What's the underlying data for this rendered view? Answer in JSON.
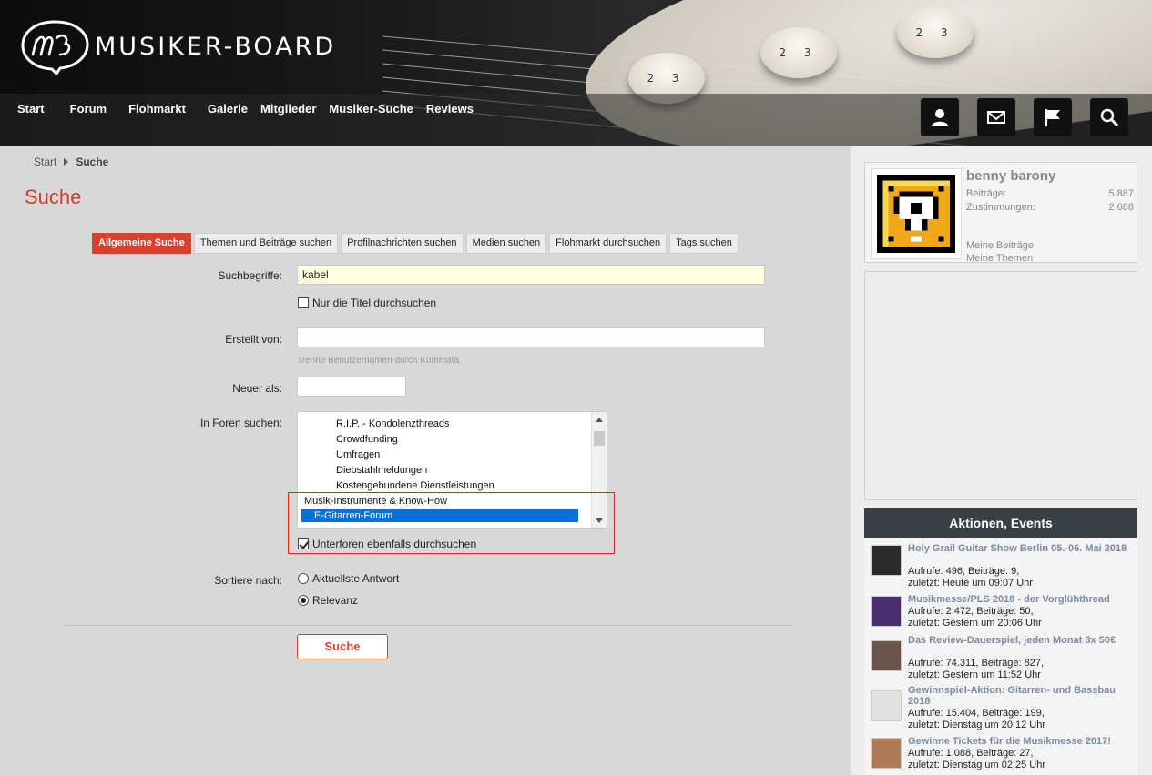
{
  "site": {
    "name": "MUSIKER-BOARD"
  },
  "nav": [
    "Start",
    "Forum",
    "Flohmarkt",
    "Galerie",
    "Mitglieder",
    "Musiker-Suche",
    "Reviews"
  ],
  "breadcrumb": {
    "home": "Start",
    "current": "Suche"
  },
  "page_title": "Suche",
  "tabs": [
    "Allgemeine Suche",
    "Themen und Beiträge suchen",
    "Profilnachrichten suchen",
    "Medien suchen",
    "Flohmarkt durchsuchen",
    "Tags suchen"
  ],
  "form": {
    "keywords_label": "Suchbegriffe:",
    "keywords_value": "kabel",
    "titles_only_label": "Nur die Titel durchsuchen",
    "created_by_label": "Erstellt von:",
    "created_by_hint": "Trenne Benutzernamen durch Kommata.",
    "newer_than_label": "Neuer als:",
    "forums_label": "In Foren suchen:",
    "forums": [
      "R.I.P. - Kondolenzthreads",
      "Crowdfunding",
      "Umfragen",
      "Diebstahlmeldungen",
      "Kostengebundene Dienstleistungen",
      "Musik-Instrumente & Know-How",
      "E-Gitarren-Forum"
    ],
    "subforums_label": "Unterforen ebenfalls durchsuchen",
    "sort_label": "Sortiere nach:",
    "sort_latest": "Aktuellste Antwort",
    "sort_relevance": "Relevanz",
    "submit": "Suche"
  },
  "user": {
    "name": "benny barony",
    "posts_label": "Beiträge:",
    "posts": "5.887",
    "likes_label": "Zustimmungen:",
    "likes": "2.688",
    "my_posts": "Meine Beiträge",
    "my_threads": "Meine Themen"
  },
  "events": {
    "heading": "Aktionen, Events",
    "items": [
      {
        "title": "Holy Grail Guitar Show Berlin 05.-06. Mai 2018",
        "stats": "Aufrufe: 496, Beiträge: 9,",
        "last": "zuletzt: Heute um 09:07 Uhr"
      },
      {
        "title": "Musikmesse/PLS 2018 - der Vorglühthread",
        "stats": "Aufrufe: 2.472, Beiträge: 50,",
        "last": "zuletzt: Gestern um 20:06 Uhr"
      },
      {
        "title": "Das Review-Dauerspiel, jeden Monat 3x 50€",
        "stats": "Aufrufe: 74.311, Beiträge: 827,",
        "last": "zuletzt: Gestern um 11:52 Uhr"
      },
      {
        "title": "Gewinnspiel-Aktion: Gitarren- und Bassbau 2018",
        "stats": "Aufrufe: 15.404, Beiträge: 199,",
        "last": "zuletzt: Dienstag um 20:12 Uhr"
      },
      {
        "title": "Gewinne Tickets für die Musikmesse 2017!",
        "stats": "Aufrufe: 1.088, Beiträge: 27,",
        "last": "zuletzt: Dienstag um 02:25 Uhr"
      }
    ]
  },
  "icons": [
    "user-icon",
    "mail-icon",
    "flag-icon",
    "search-icon"
  ],
  "colors": {
    "accent": "#d9412f",
    "selection": "#0a6fd6",
    "highlight_box": "#e52222"
  }
}
